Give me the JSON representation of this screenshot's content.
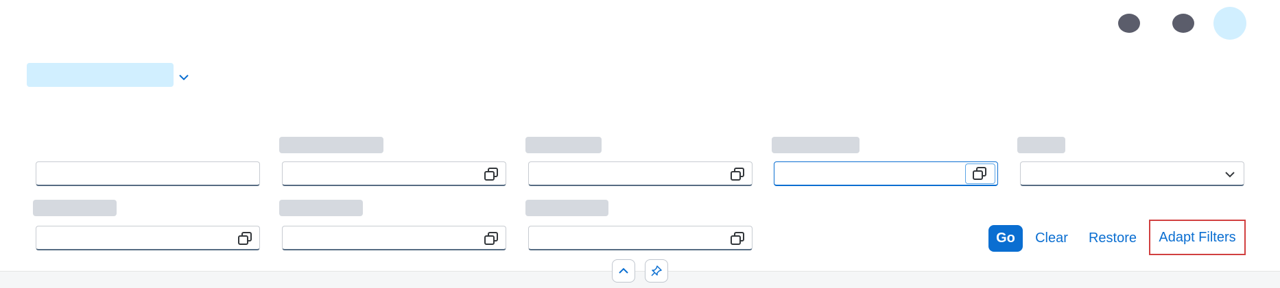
{
  "shell": {
    "icons": [
      "notifications-icon",
      "help-icon"
    ],
    "avatar_color": "#d1efff"
  },
  "variant": {
    "title": "",
    "chevron_icon": "chevron-down-icon"
  },
  "filters": {
    "row1": [
      {
        "label": "",
        "value": "",
        "placeholder": "",
        "icon": "none"
      },
      {
        "label": "",
        "value": "",
        "placeholder": "",
        "icon": "value-help-icon"
      },
      {
        "label": "",
        "value": "",
        "placeholder": "",
        "icon": "value-help-icon"
      },
      {
        "label": "",
        "value": "",
        "placeholder": "",
        "icon": "value-help-icon",
        "focused": true
      },
      {
        "label": "",
        "value": "",
        "placeholder": "",
        "icon": "chevron-down-icon"
      }
    ],
    "row2": [
      {
        "label": "",
        "value": "",
        "placeholder": "",
        "icon": "value-help-icon"
      },
      {
        "label": "",
        "value": "",
        "placeholder": "",
        "icon": "value-help-icon"
      },
      {
        "label": "",
        "value": "",
        "placeholder": "",
        "icon": "value-help-icon"
      }
    ]
  },
  "actions": {
    "go_label": "Go",
    "clear_label": "Clear",
    "restore_label": "Restore",
    "adapt_filters_label": "Adapt Filters"
  },
  "footer": {
    "collapse_icon": "chevron-up-icon",
    "pin_icon": "pin-icon"
  },
  "colors": {
    "accent": "#0a6ed1",
    "highlight_border": "#d13f3f",
    "skeleton": "#d5d9df"
  }
}
